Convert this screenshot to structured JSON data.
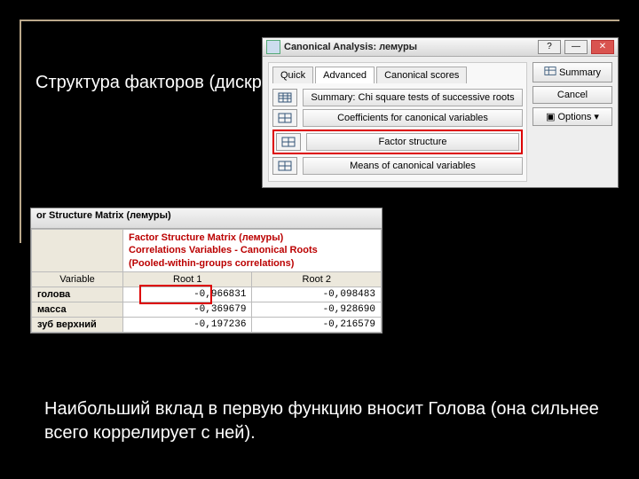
{
  "slide": {
    "title_lines": "Структура факторов (дискриминантных функций)",
    "bottom_text": "Наибольший вклад в первую функцию вносит Голова (она сильнее всего коррелирует с ней)."
  },
  "dialog": {
    "title": "Canonical Analysis: лемуры",
    "tabs": {
      "quick": "Quick",
      "advanced": "Advanced",
      "scores": "Canonical scores"
    },
    "buttons": {
      "summary": "Summary: Chi square tests of successive roots",
      "coefficients": "Coefficients for canonical variables",
      "factor_structure": "Factor structure",
      "means": "Means of canonical variables"
    },
    "right": {
      "summary": "Summary",
      "cancel": "Cancel",
      "options": "Options"
    }
  },
  "sheet": {
    "window_title": "or Structure Matrix (лемуры)",
    "header_line1": "Factor Structure Matrix (лемуры)",
    "header_line2": "Correlations Variables - Canonical Roots",
    "header_line3": "(Pooled-within-groups correlations)",
    "var_col": "Variable",
    "cols": {
      "r1": "Root 1",
      "r2": "Root 2"
    },
    "rows": {
      "r1name": "голова",
      "r2name": "масса",
      "r3name": "зуб верхний"
    }
  },
  "chart_data": {
    "type": "table",
    "title": "Factor Structure Matrix (лемуры) — Correlations Variables vs Canonical Roots (pooled-within-groups)",
    "columns": [
      "Variable",
      "Root 1",
      "Root 2"
    ],
    "rows": [
      {
        "variable": "голова",
        "root1": -0.966831,
        "root2": -0.098483
      },
      {
        "variable": "масса",
        "root1": -0.369679,
        "root2": -0.92869
      },
      {
        "variable": "зуб верхний",
        "root1": -0.197236,
        "root2": -0.216579
      }
    ],
    "cells": {
      "r1c1": "-0,966831",
      "r1c2": "-0,098483",
      "r2c1": "-0,369679",
      "r2c2": "-0,928690",
      "r3c1": "-0,197236",
      "r3c2": "-0,216579"
    }
  }
}
